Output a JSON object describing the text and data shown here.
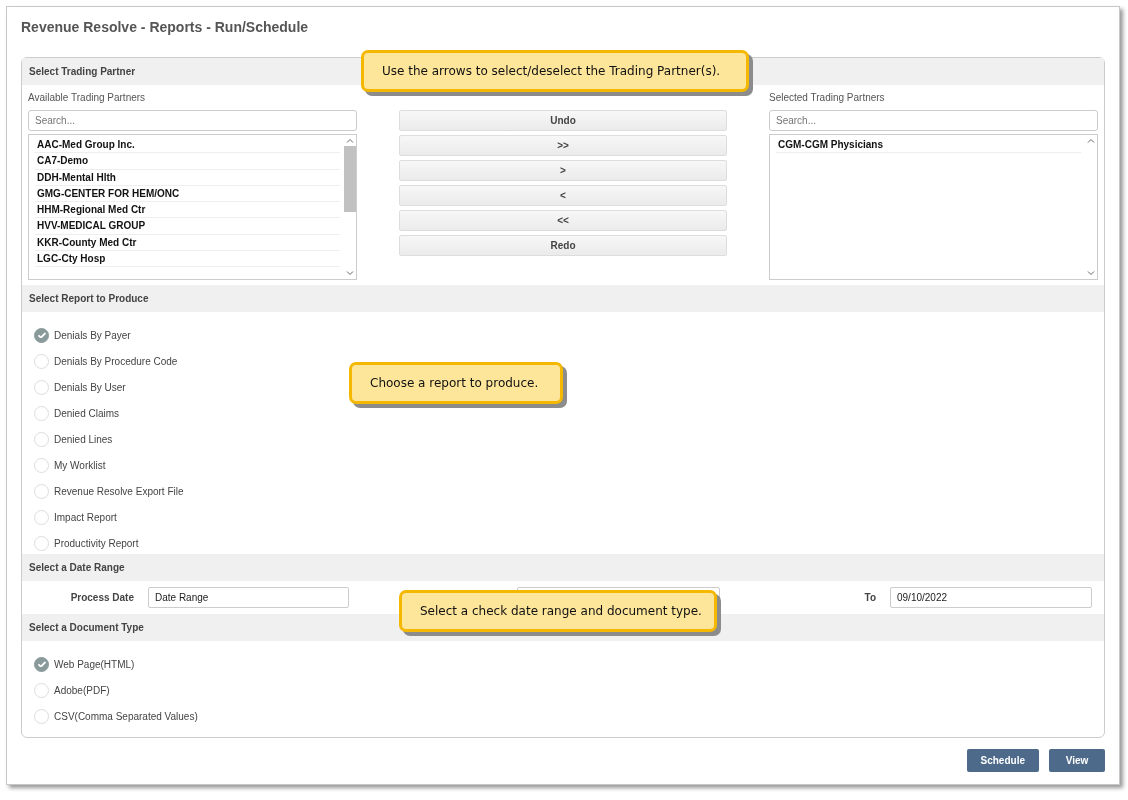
{
  "title": "Revenue Resolve - Reports - Run/Schedule",
  "trading_partner": {
    "header": "Select Trading Partner",
    "available": {
      "label": "Available Trading Partners",
      "placeholder": "Search...",
      "items": [
        "AAC-Med Group Inc.",
        "CA7-Demo",
        "DDH-Mental Hlth",
        "GMG-CENTER FOR HEM/ONC",
        "HHM-Regional Med Ctr",
        "HVV-MEDICAL GROUP",
        "KKR-County Med Ctr",
        "LGC-Cty Hosp"
      ]
    },
    "buttons": [
      "Undo",
      ">>",
      ">",
      "<",
      "<<",
      "Redo"
    ],
    "selected": {
      "label": "Selected Trading Partners",
      "placeholder": "Search...",
      "items": [
        "CGM-CGM Physicians"
      ]
    }
  },
  "report": {
    "header": "Select Report to Produce",
    "options": [
      {
        "label": "Denials By Payer",
        "selected": true
      },
      {
        "label": "Denials By Procedure Code",
        "selected": false
      },
      {
        "label": "Denials By User",
        "selected": false
      },
      {
        "label": "Denied Claims",
        "selected": false
      },
      {
        "label": "Denied Lines",
        "selected": false
      },
      {
        "label": "My Worklist",
        "selected": false
      },
      {
        "label": "Revenue Resolve Export File",
        "selected": false
      },
      {
        "label": "Impact Report",
        "selected": false
      },
      {
        "label": "Productivity Report",
        "selected": false
      }
    ]
  },
  "date_range": {
    "header": "Select a Date Range",
    "process_label": "Process Date",
    "process_value": "Date Range",
    "to_label": "To",
    "to_value": "09/10/2022"
  },
  "document_type": {
    "header": "Select a Document Type",
    "options": [
      {
        "label": "Web Page(HTML)",
        "selected": true
      },
      {
        "label": "Adobe(PDF)",
        "selected": false
      },
      {
        "label": "CSV(Comma Separated Values)",
        "selected": false
      }
    ]
  },
  "actions": [
    "Schedule",
    "View"
  ],
  "callouts": [
    {
      "text": "Use the arrows to select/deselect the Trading Partner(s).",
      "kind": "partners"
    },
    {
      "text": "Choose a report to produce.",
      "kind": "report"
    },
    {
      "text": "Select a check date range and document type.",
      "kind": "date"
    }
  ]
}
